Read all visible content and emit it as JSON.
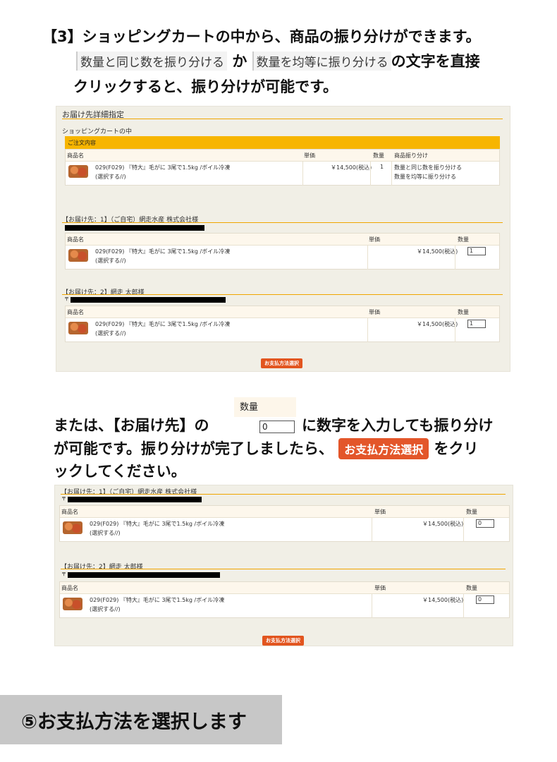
{
  "intro": {
    "heading": "【3】ショッピングカートの中から、商品の振り分けができます。",
    "chip1": "数量と同じ数を振り分ける",
    "ka": "か",
    "chip2": "数量を均等に振り分ける",
    "tail1": "の文字を直接",
    "line3": "クリックすると、振り分けが可能です。"
  },
  "panel1": {
    "title": "お届け先詳細指定",
    "cart_title": "ショッピングカートの中",
    "order_bar": "ご注文内容",
    "cart_headers": {
      "item": "商品名",
      "price": "単価",
      "qty": "数量",
      "split": "商品振り分け"
    },
    "cart_row": {
      "name": "029(F029) 『特大』毛がに 3尾で1.5kg /ボイル冷凍",
      "select": "(選択する//)",
      "price": "￥14,500(税込)",
      "qty": "1",
      "split_a": "数量と同じ数を振り分ける",
      "split_b": "数量を均等に振り分ける"
    },
    "dest1_title": "【お届け先：1】（ご自宅）網走水産 株式会社様",
    "dest2_title": "【お届け先：2】網走 太郎様",
    "postal_mark": "〒",
    "headers": {
      "item": "商品名",
      "price": "単価",
      "qty": "数量"
    },
    "row": {
      "name": "029(F029) 『特大』毛がに 3尾で1.5kg /ボイル冷凍",
      "select": "(選択する//)",
      "price": "￥14,500(税込)"
    },
    "dest1_qty": "1",
    "dest2_qty": "1",
    "pay_button": "お支払方法選択"
  },
  "middle": {
    "qty_label": "数量",
    "qty_value": "0",
    "text_a": "または、【お届け先】の",
    "text_b": "に数字を入力しても振り分け",
    "text_c": "が可能です。振り分けが完了しましたら、",
    "button": "お支払方法選択",
    "text_d": "をクリ",
    "text_e": "ックしてください。"
  },
  "panel2": {
    "dest1_title": "【お届け先：1】（ご自宅）網走水産 株式会社様",
    "dest2_title": "【お届け先：2】網走 太郎様",
    "postal_mark": "〒",
    "headers": {
      "item": "商品名",
      "price": "単価",
      "qty": "数量"
    },
    "row": {
      "name": "029(F029) 『特大』毛がに 3尾で1.5kg /ボイル冷凍",
      "select": "(選択する//)",
      "price": "￥14,500(税込)"
    },
    "dest1_qty": "0",
    "dest2_qty": "0",
    "pay_button": "お支払方法選択"
  },
  "footer": {
    "label": "⑤お支払方法を選択します"
  },
  "colors": {
    "accent": "#f0a500",
    "button": "#e2551f",
    "footer_bg": "#c7c7c7"
  }
}
